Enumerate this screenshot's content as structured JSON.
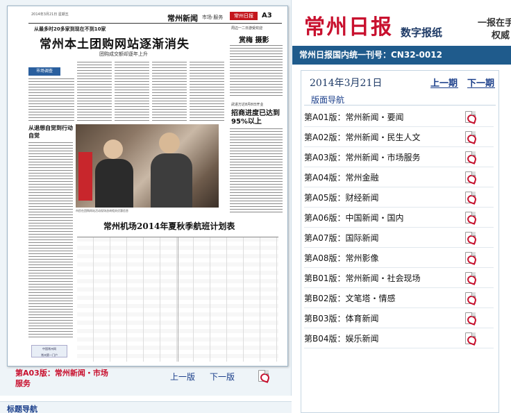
{
  "brand": {
    "name": "常州日报",
    "subtitle": "数字报纸",
    "slogan_line1": "一报在手",
    "slogan_line2": "权威"
  },
  "issn": "常州日报国内统一刊号：CN32-0012",
  "date": {
    "label": "2014年3月21日",
    "prev": "上一期",
    "next": "下一期"
  },
  "nav_heading": "版面导航",
  "pages": [
    {
      "label": "第A01版：常州新闻・要闻"
    },
    {
      "label": "第A02版：常州新闻・民生人文"
    },
    {
      "label": "第A03版：常州新闻・市场服务"
    },
    {
      "label": "第A04版：常州金融"
    },
    {
      "label": "第A05版：财经新闻"
    },
    {
      "label": "第A06版：中国新闻・国内"
    },
    {
      "label": "第A07版：国际新闻"
    },
    {
      "label": "第A08版：常州影像"
    },
    {
      "label": "第B01版：常州新闻・社会现场"
    },
    {
      "label": "第B02版：文笔塔・情感"
    },
    {
      "label": "第B03版：体育新闻"
    },
    {
      "label": "第B04版：娱乐新闻"
    }
  ],
  "current_page": {
    "title": "第A03版：常州新闻・市场服务",
    "prev": "上一版",
    "next": "下一版"
  },
  "newspaper": {
    "section": "常州新闻",
    "section_sub": "市场·服务",
    "masthead": "常州日报",
    "page_no": "A3",
    "kicker": "从最多时20多家到现在不到10家",
    "headline": "常州本土团购网站逐渐消失",
    "deck": "团购成交额却逐年上升",
    "badge": "市场调查",
    "left_head": "从退想自觉到行动自觉",
    "side_head": "赏梅 摄影",
    "side_head2": "招商进度已达到95%以上",
    "table_title": "常州机场2014年夏秋季航班计划表"
  },
  "bottom_label": "标题导航",
  "colors": {
    "brand_red": "#c8102e",
    "bar_blue": "#1f5b8c",
    "link_blue": "#1a3e8a"
  }
}
